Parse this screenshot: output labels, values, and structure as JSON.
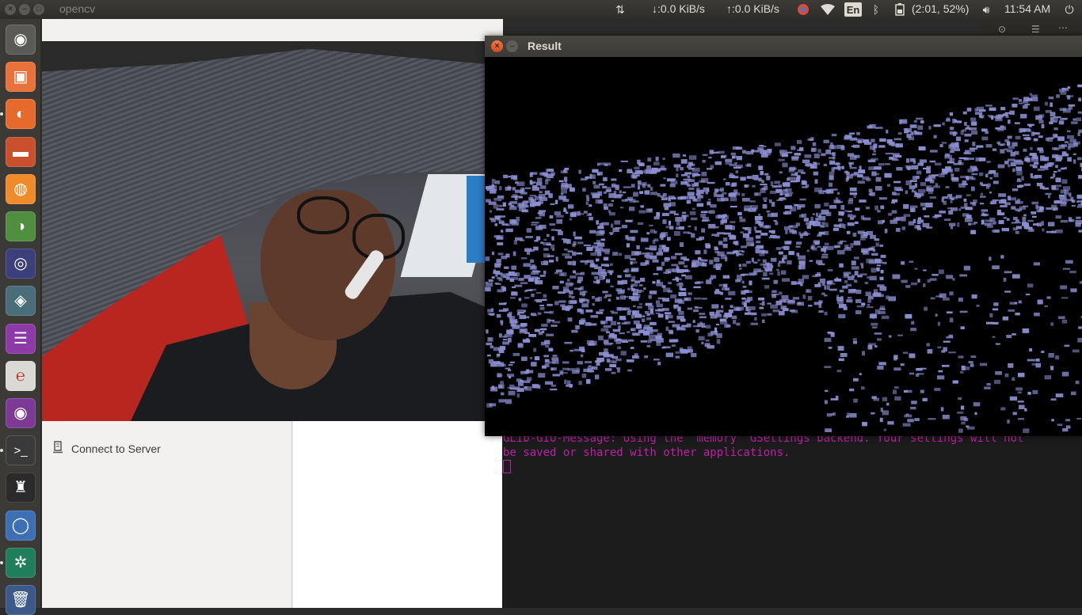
{
  "top_panel": {
    "app_title": "opencv",
    "net_down": "↓:0.0 KiB/s",
    "net_up": "↑:0.0 KiB/s",
    "keyboard_layout": "En",
    "battery": "(2:01, 52%)",
    "clock": "11:54 AM",
    "window_close_glyph": "×",
    "window_min_glyph": "–",
    "window_max_glyph": "□"
  },
  "launcher": {
    "items": [
      {
        "name": "ubuntu-dash-icon",
        "glyph": "◉",
        "bg": "#5a5a57"
      },
      {
        "name": "screenshot-icon",
        "glyph": "▣",
        "bg": "#e9713a"
      },
      {
        "name": "firefox-icon",
        "glyph": "◐",
        "bg": "#e66a2c"
      },
      {
        "name": "files-icon",
        "glyph": "▬",
        "bg": "#c94f2d"
      },
      {
        "name": "software-center-icon",
        "glyph": "◍",
        "bg": "#f08b2a"
      },
      {
        "name": "settings-toggle-icon",
        "glyph": "◑",
        "bg": "#4f8e3e"
      },
      {
        "name": "eclipse-icon",
        "glyph": "◎",
        "bg": "#3b3f7a"
      },
      {
        "name": "pdf-viewer-icon",
        "glyph": "◈",
        "bg": "#4a6d7a"
      },
      {
        "name": "text-editor-icon",
        "glyph": "☰",
        "bg": "#8d3aa8"
      },
      {
        "name": "e-reader-icon",
        "glyph": "℮",
        "bg": "#dad9d6"
      },
      {
        "name": "camera-app-icon",
        "glyph": "◉",
        "bg": "#7d3a95"
      },
      {
        "name": "terminal-icon",
        "glyph": ">_",
        "bg": "#3a3a3a"
      },
      {
        "name": "chess-icon",
        "glyph": "♜",
        "bg": "#2a2a2a"
      },
      {
        "name": "chromium-icon",
        "glyph": "◯",
        "bg": "#3d6fb5"
      },
      {
        "name": "app-grid-icon",
        "glyph": "✲",
        "bg": "#1f7f5c"
      },
      {
        "name": "trash-icon",
        "glyph": "🗑",
        "bg": "#3b5a8a"
      }
    ]
  },
  "file_manager": {
    "connect_server_label": "Connect to Server",
    "connect_server_icon": "server-icon"
  },
  "terminal": {
    "line1": "GLib-GIO-Message: Using the 'memory' GSettings backend.  Your settings will not",
    "line2": "be saved or shared with other applications."
  },
  "result_window": {
    "title": "Result",
    "close_glyph": "×",
    "min_glyph": "–"
  },
  "webcam_window": {
    "title": ""
  },
  "colors": {
    "terminal_text": "#c01fa8",
    "panel_bg": "#3c3b37",
    "result_speckle": "#8c8fd2"
  }
}
